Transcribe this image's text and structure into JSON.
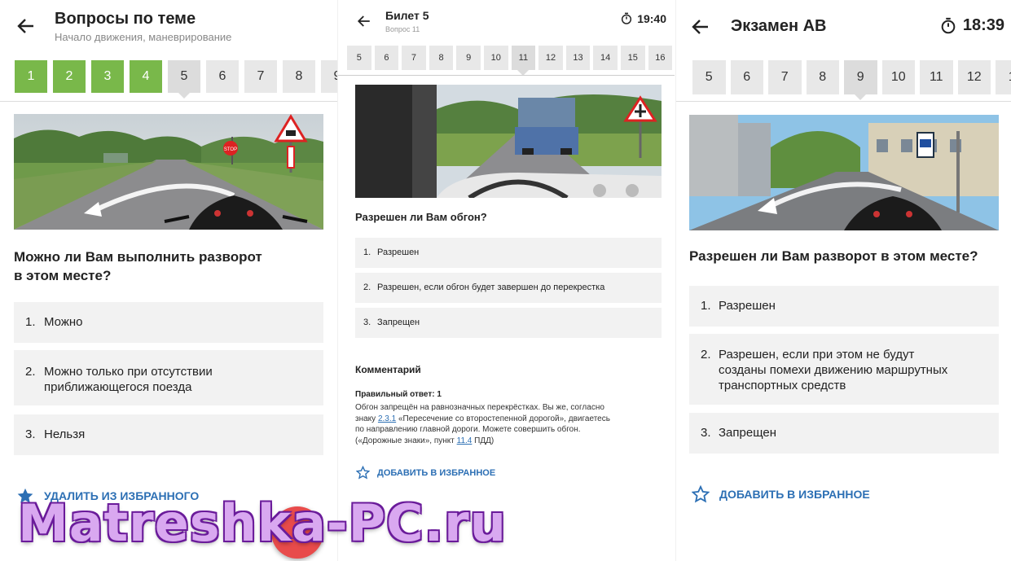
{
  "panel1": {
    "title": "Вопросы по теме",
    "subtitle": "Начало движения, маневрирование",
    "numbers": [
      "1",
      "2",
      "3",
      "4",
      "5",
      "6",
      "7",
      "8",
      "9"
    ],
    "question_line1": "Можно ли Вам выполнить разворот",
    "question_line2": "в этом месте?",
    "answers": [
      {
        "num": "1.",
        "line1": "Можно",
        "line2": ""
      },
      {
        "num": "2.",
        "line1": "Можно только при отсутствии",
        "line2": "приближающегося поезда"
      },
      {
        "num": "3.",
        "line1": "Нельзя",
        "line2": ""
      }
    ],
    "favorite_label": "Удалить из избранного",
    "sign_text": "STOP"
  },
  "panel2": {
    "title": "Билет 5",
    "subtitle": "Вопрос 11",
    "timer": "19:40",
    "numbers": [
      "5",
      "6",
      "7",
      "8",
      "9",
      "10",
      "11",
      "12",
      "13",
      "14",
      "15",
      "16"
    ],
    "question": "Разрешен ли Вам обгон?",
    "answers": [
      {
        "num": "1.",
        "text": "Разрешен"
      },
      {
        "num": "2.",
        "text": "Разрешен, если обгон будет завершен до перекрестка"
      },
      {
        "num": "3.",
        "text": "Запрещен"
      }
    ],
    "comment_title": "Комментарий",
    "correct_answer": "Правильный ответ: 1",
    "comment_a": "Обгон запрещён на равнозначных перекрёстках. Вы же, согласно",
    "comment_b1": "знаку ",
    "comment_link1": "2.3.1",
    "comment_b2": " «Пересечение со второстепенной дорогой», двигаетесь",
    "comment_c": "по направлению главной дороги. Можете совершить обгон.",
    "comment_d1": "(«Дорожные знаки», пункт ",
    "comment_link2": "11.4",
    "comment_d2": " ПДД)",
    "favorite_label": "Добавить в избранное"
  },
  "panel3": {
    "title": "Экзамен АВ",
    "timer": "18:39",
    "numbers": [
      "5",
      "6",
      "7",
      "8",
      "9",
      "10",
      "11",
      "12",
      "1"
    ],
    "question": "Разрешен ли Вам разворот в этом месте?",
    "answers": [
      {
        "num": "1.",
        "line1": "Разрешен",
        "line2": "",
        "line3": ""
      },
      {
        "num": "2.",
        "line1": "Разрешен, если при этом не будут",
        "line2": "созданы помехи движению маршрутных",
        "line3": "транспортных средств"
      },
      {
        "num": "3.",
        "line1": "Запрещен",
        "line2": "",
        "line3": ""
      }
    ],
    "favorite_label": "Добавить в избранное"
  },
  "watermark": "Matreshka-PC.ru",
  "fab_icon": "?",
  "icons": {
    "back": "arrow-left-icon",
    "timer": "stopwatch-icon",
    "star": "star-icon"
  },
  "colors": {
    "green": "#79b84a",
    "accent": "#2c6fb4",
    "fab": "#e84b4b"
  }
}
